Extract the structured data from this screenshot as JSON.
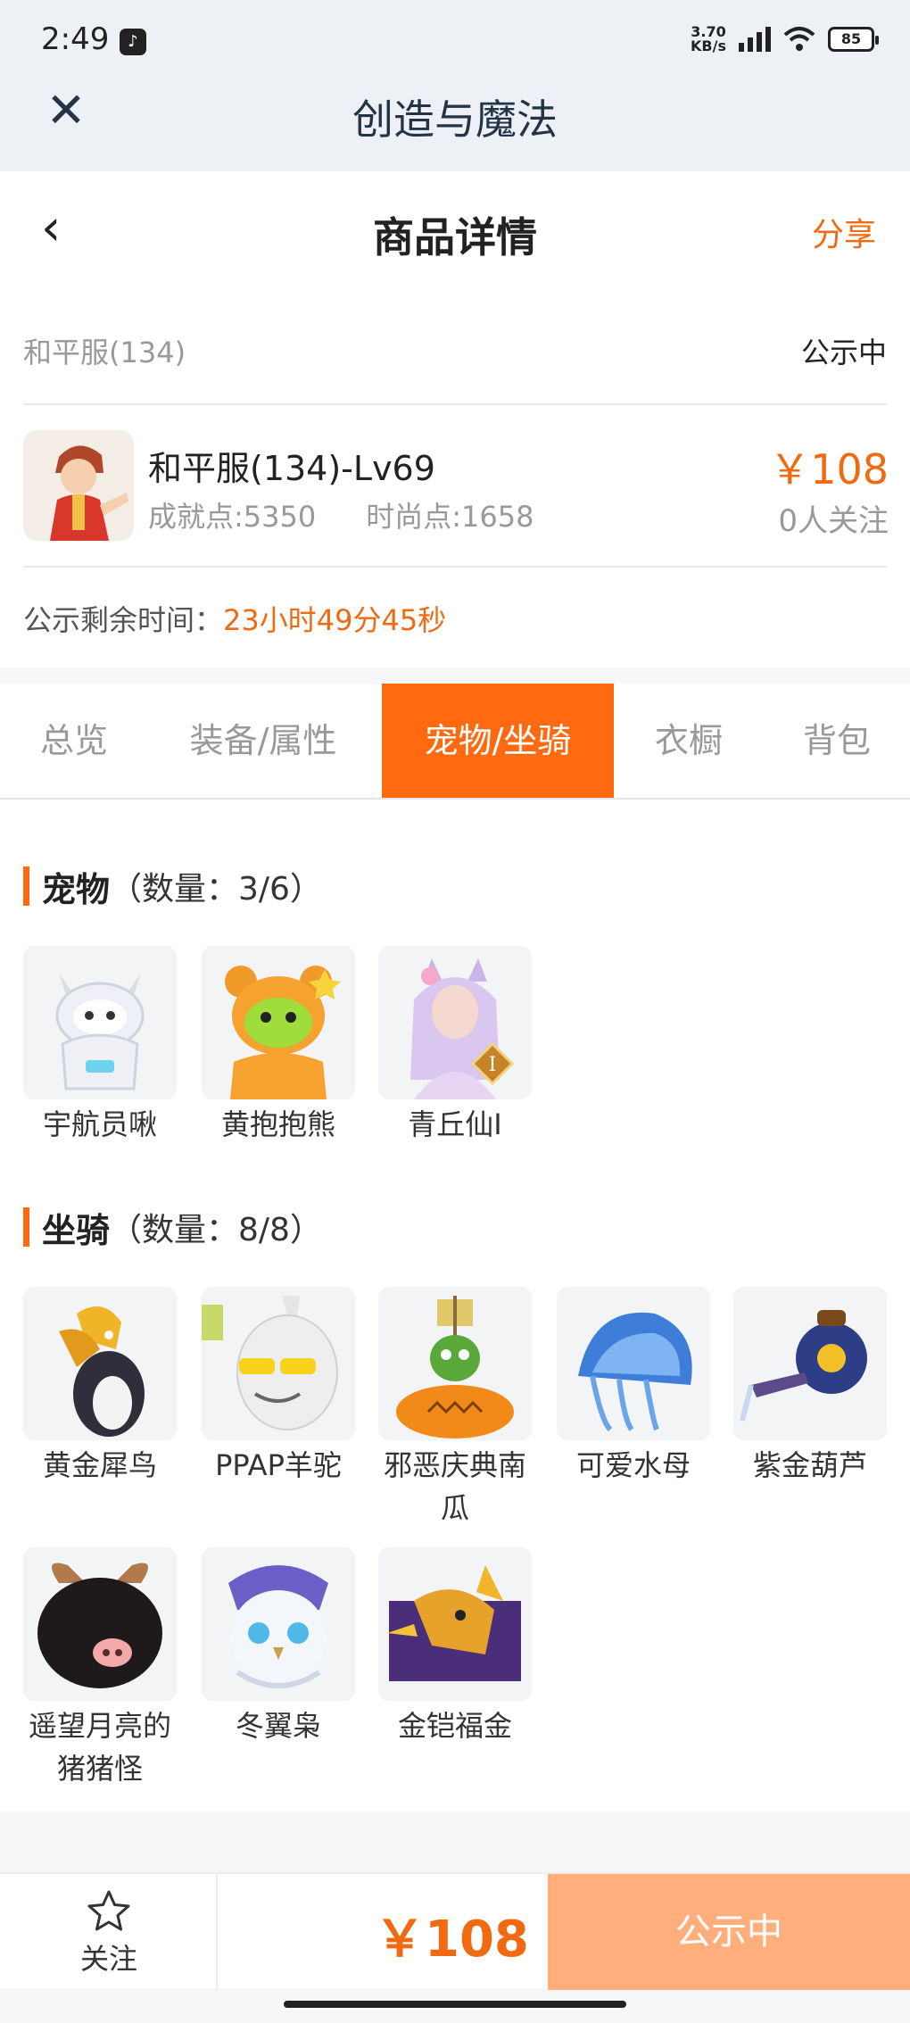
{
  "status_bar": {
    "time": "2:49",
    "net_speed_value": "3.70",
    "net_speed_unit": "KB/s",
    "battery": "85"
  },
  "app": {
    "title": "创造与魔法"
  },
  "header": {
    "title": "商品详情",
    "share_label": "分享"
  },
  "product": {
    "server": "和平服(134)",
    "status": "公示中",
    "name": "和平服(134)-Lv69",
    "achievement_points": "成就点:5350",
    "fashion_points": "时尚点:1658",
    "price": "￥108",
    "followers": "0人关注",
    "remaining_label": "公示剩余时间：",
    "remaining_time": "23小时49分45秒"
  },
  "tabs": [
    "总览",
    "装备/属性",
    "宠物/坐骑",
    "衣橱",
    "背包"
  ],
  "active_tab": "宠物/坐骑",
  "pets": {
    "title": "宠物",
    "count": "（数量：3/6）",
    "items": [
      "宇航员啾",
      "黄抱抱熊",
      "青丘仙I"
    ]
  },
  "mounts": {
    "title": "坐骑",
    "count": "（数量：8/8）",
    "items": [
      "黄金犀鸟",
      "PPAP羊驼",
      "邪恶庆典南瓜",
      "可爱水母",
      "紫金葫芦",
      "遥望月亮的猪猪怪",
      "冬翼枭",
      "金铠福金"
    ]
  },
  "bottom_bar": {
    "follow_label": "关注",
    "price": "￥108",
    "status_button": "公示中"
  },
  "colors": {
    "accent": "#ff6a10",
    "accent_text": "#f06a12",
    "status_button_bg": "#ffae7c"
  }
}
